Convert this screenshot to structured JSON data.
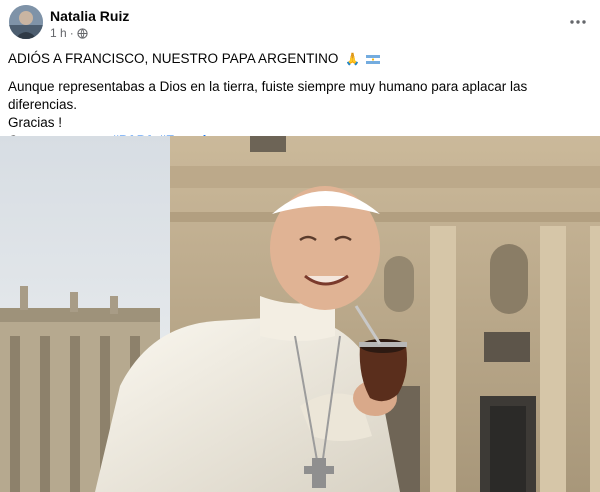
{
  "post": {
    "author": "Natalia Ruiz",
    "time": "1 h",
    "separator": "·",
    "headline": "ADIÓS A FRANCISCO, NUESTRO PAPA ARGENTINO",
    "headline_emoji": "🙏",
    "body_line": "Aunque representabas a Dios en la tierra, fuiste siempre muy humano para aplacar las diferencias.",
    "thanks": "Gracias !",
    "closing": "Oramos por vos.",
    "hashtags": [
      "#PAPA",
      "#Francisco"
    ]
  },
  "icons": {
    "more": "more-options-icon",
    "privacy": "globe-icon",
    "flag": "argentina-flag-icon"
  },
  "colors": {
    "link": "#1877f2",
    "meta": "#65676b",
    "text": "#050505"
  }
}
